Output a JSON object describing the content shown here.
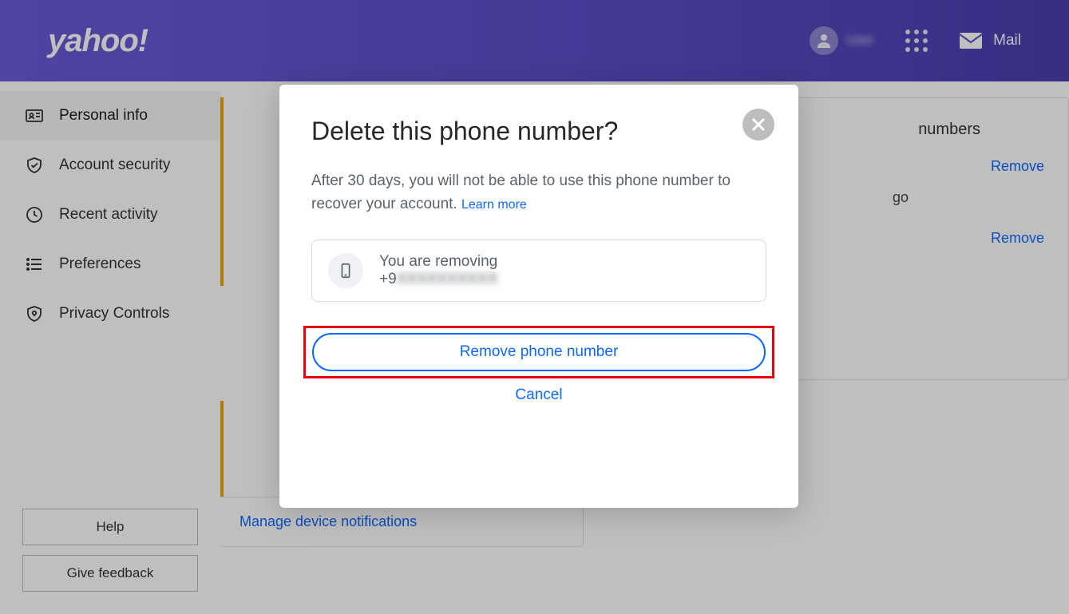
{
  "header": {
    "logo_text": "yahoo!",
    "username": "User",
    "mail_label": "Mail"
  },
  "sidebar": {
    "items": [
      {
        "label": "Personal info"
      },
      {
        "label": "Account security"
      },
      {
        "label": "Recent activity"
      },
      {
        "label": "Preferences"
      },
      {
        "label": "Privacy Controls"
      }
    ],
    "help_label": "Help",
    "feedback_label": "Give feedback"
  },
  "background": {
    "right_card_title_fragment": "numbers",
    "ago_text": "go",
    "remove1": "Remove",
    "remove2": "Remove",
    "manage_link": "Manage device notifications"
  },
  "modal": {
    "title": "Delete this phone number?",
    "description": "After 30 days, you will not be able to use this phone number to recover your account.",
    "learn_more": "Learn more",
    "removing_label": "You are removing",
    "phone_prefix": "+9",
    "phone_rest": "XXXXXXXXXX",
    "remove_button": "Remove phone number",
    "cancel": "Cancel"
  }
}
